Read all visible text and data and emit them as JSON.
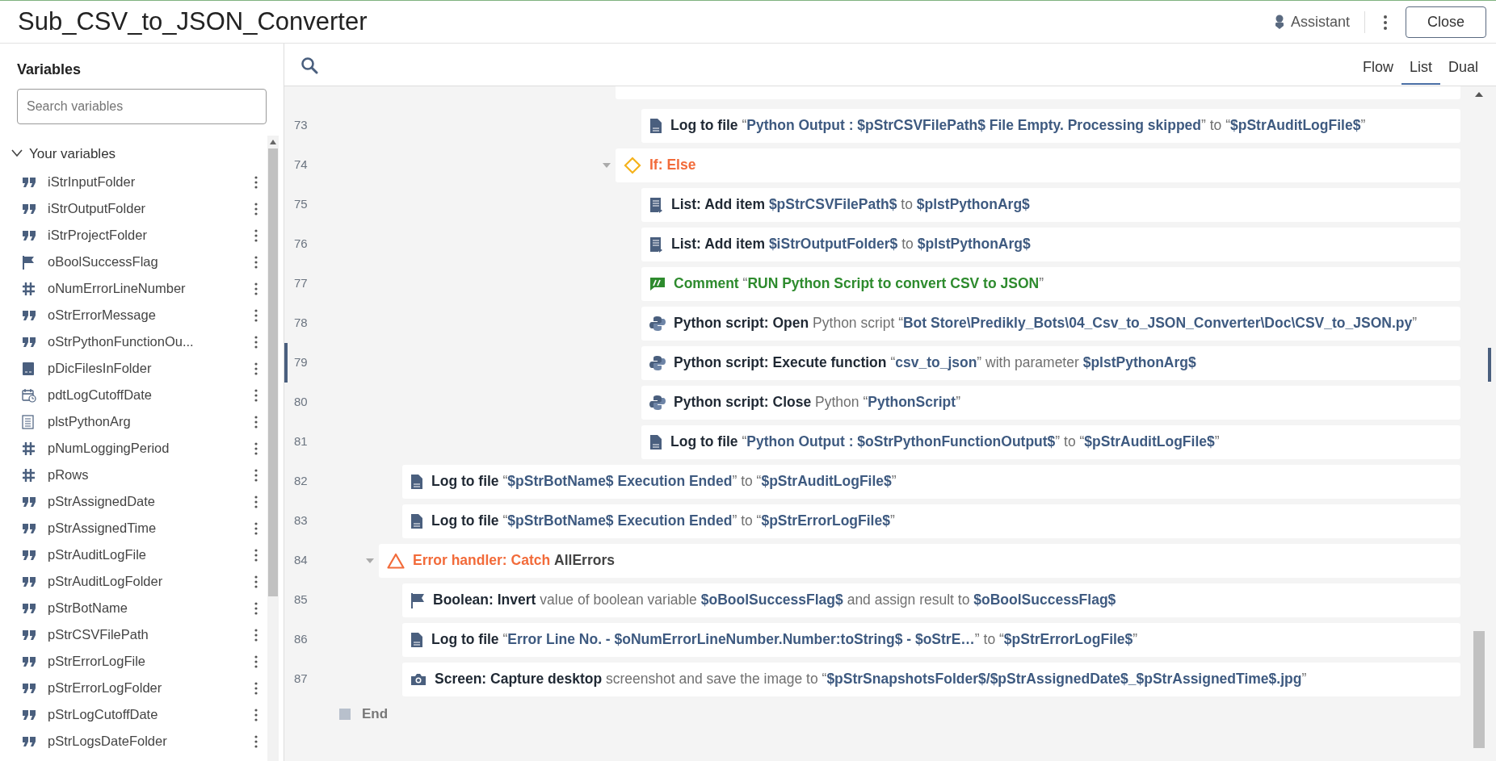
{
  "window": {
    "title": "Sub_CSV_to_JSON_Converter"
  },
  "header": {
    "assistant": "Assistant",
    "close_button": "Close"
  },
  "sidebar": {
    "title": "Variables",
    "search": {
      "placeholder": "Search variables"
    },
    "group": {
      "label": "Your variables",
      "expanded": true
    },
    "variables": [
      {
        "name": "iStrInputFolder",
        "kind": "string"
      },
      {
        "name": "iStrOutputFolder",
        "kind": "string"
      },
      {
        "name": "iStrProjectFolder",
        "kind": "string"
      },
      {
        "name": "oBoolSuccessFlag",
        "kind": "boolean"
      },
      {
        "name": "oNumErrorLineNumber",
        "kind": "number"
      },
      {
        "name": "oStrErrorMessage",
        "kind": "string"
      },
      {
        "name": "oStrPythonFunctionOu...",
        "kind": "string"
      },
      {
        "name": "pDicFilesInFolder",
        "kind": "dictionary"
      },
      {
        "name": "pdtLogCutoffDate",
        "kind": "datetime"
      },
      {
        "name": "plstPythonArg",
        "kind": "list"
      },
      {
        "name": "pNumLoggingPeriod",
        "kind": "number"
      },
      {
        "name": "pRows",
        "kind": "number"
      },
      {
        "name": "pStrAssignedDate",
        "kind": "string"
      },
      {
        "name": "pStrAssignedTime",
        "kind": "string"
      },
      {
        "name": "pStrAuditLogFile",
        "kind": "string"
      },
      {
        "name": "pStrAuditLogFolder",
        "kind": "string"
      },
      {
        "name": "pStrBotName",
        "kind": "string"
      },
      {
        "name": "pStrCSVFilePath",
        "kind": "string"
      },
      {
        "name": "pStrErrorLogFile",
        "kind": "string"
      },
      {
        "name": "pStrErrorLogFolder",
        "kind": "string"
      },
      {
        "name": "pStrLogCutoffDate",
        "kind": "string"
      },
      {
        "name": "pStrLogsDateFolder",
        "kind": "string"
      }
    ]
  },
  "view_tabs": [
    {
      "label": "Flow",
      "selected": false
    },
    {
      "label": "List",
      "selected": true
    },
    {
      "label": "Dual",
      "selected": false
    }
  ],
  "steps": [
    {
      "kind": "tail",
      "children": [
        {
          "kind": "tail",
          "children": [
            {
              "kind": "cut",
              "children": [
                {
                  "kind": "log",
                  "line": "73",
                  "current": false,
                  "parts": [
                    {
                      "command": "Log to file"
                    },
                    {
                      "text": "“"
                    },
                    {
                      "value": "Python Output : $pStrCSVFilePath$ File Empty. Processing skipped"
                    },
                    {
                      "text": "” to “"
                    },
                    {
                      "value": "$pStrAuditLogFile$"
                    },
                    {
                      "text": "”"
                    }
                  ]
                }
              ]
            },
            {
              "kind": "if",
              "line": "74",
              "current": false,
              "parts": [
                {
                  "command": "If: Else"
                }
              ],
              "children": [
                {
                  "kind": "list",
                  "line": "75",
                  "current": false,
                  "parts": [
                    {
                      "command": "List: Add item"
                    },
                    {
                      "value": "$pStrCSVFilePath$"
                    },
                    {
                      "text": "to"
                    },
                    {
                      "value": "$plstPythonArg$"
                    }
                  ]
                },
                {
                  "kind": "list",
                  "line": "76",
                  "current": false,
                  "parts": [
                    {
                      "command": "List: Add item"
                    },
                    {
                      "value": "$iStrOutputFolder$"
                    },
                    {
                      "text": "to"
                    },
                    {
                      "value": "$plstPythonArg$"
                    }
                  ]
                },
                {
                  "kind": "comment",
                  "line": "77",
                  "current": false,
                  "parts": [
                    {
                      "command": "Comment"
                    },
                    {
                      "text": "“"
                    },
                    {
                      "value": "RUN Python Script to convert CSV to JSON"
                    },
                    {
                      "text": "”"
                    }
                  ]
                },
                {
                  "kind": "python",
                  "line": "78",
                  "current": false,
                  "parts": [
                    {
                      "command": "Python script: Open"
                    },
                    {
                      "text": "Python script “"
                    },
                    {
                      "value": "Bot Store\\Predikly_Bots\\04_Csv_to_JSON_Converter\\Doc\\CSV_to_JSON.py"
                    },
                    {
                      "text": "”"
                    }
                  ]
                },
                {
                  "kind": "python",
                  "line": "79",
                  "current": true,
                  "parts": [
                    {
                      "command": "Python script: Execute function"
                    },
                    {
                      "text": "“"
                    },
                    {
                      "value": "csv_to_json"
                    },
                    {
                      "text": "” with parameter"
                    },
                    {
                      "value": "$plstPythonArg$"
                    }
                  ]
                },
                {
                  "kind": "python",
                  "line": "80",
                  "current": false,
                  "parts": [
                    {
                      "command": "Python script: Close"
                    },
                    {
                      "text": "Python “"
                    },
                    {
                      "value": "PythonScript"
                    },
                    {
                      "text": "”"
                    }
                  ]
                },
                {
                  "kind": "log",
                  "line": "81",
                  "current": false,
                  "parts": [
                    {
                      "command": "Log to file"
                    },
                    {
                      "text": "“"
                    },
                    {
                      "value": "Python Output : $oStrPythonFunctionOutput$"
                    },
                    {
                      "text": "” to “"
                    },
                    {
                      "value": "$pStrAuditLogFile$"
                    },
                    {
                      "text": "”"
                    }
                  ]
                }
              ]
            }
          ]
        },
        {
          "kind": "log",
          "line": "82",
          "current": false,
          "parts": [
            {
              "command": "Log to file"
            },
            {
              "text": "“"
            },
            {
              "value": "$pStrBotName$ Execution Ended"
            },
            {
              "text": "” to “"
            },
            {
              "value": "$pStrAuditLogFile$"
            },
            {
              "text": "”"
            }
          ]
        },
        {
          "kind": "log",
          "line": "83",
          "current": false,
          "parts": [
            {
              "command": "Log to file"
            },
            {
              "text": "“"
            },
            {
              "value": "$pStrBotName$ Execution Ended"
            },
            {
              "text": "” to “"
            },
            {
              "value": "$pStrErrorLogFile$"
            },
            {
              "text": "”"
            }
          ]
        }
      ]
    },
    {
      "kind": "error",
      "line": "84",
      "current": false,
      "parts": [
        {
          "command": "Error handler: Catch"
        },
        {
          "argument": "AllErrors"
        }
      ],
      "children": [
        {
          "kind": "flag",
          "line": "85",
          "current": false,
          "parts": [
            {
              "command": "Boolean: Invert"
            },
            {
              "text": "value of boolean variable"
            },
            {
              "value": "$oBoolSuccessFlag$"
            },
            {
              "text": "and assign result to"
            },
            {
              "value": "$oBoolSuccessFlag$"
            }
          ]
        },
        {
          "kind": "log",
          "line": "86",
          "current": false,
          "parts": [
            {
              "command": "Log to file"
            },
            {
              "text": "“"
            },
            {
              "value": "Error Line No. - $oNumErrorLineNumber.Number:toString$ - $oStrE…"
            },
            {
              "text": "” to “"
            },
            {
              "value": "$pStrErrorLogFile$"
            },
            {
              "text": "”"
            }
          ]
        },
        {
          "kind": "camera",
          "line": "87",
          "current": false,
          "parts": [
            {
              "command": "Screen: Capture desktop"
            },
            {
              "text": "screenshot and save the image to “"
            },
            {
              "value": "$pStrSnapshotsFolder$/$pStrAssignedDate$_$pStrAssignedTime$.jpg"
            },
            {
              "text": "”"
            }
          ]
        }
      ]
    }
  ],
  "end_label": "End"
}
